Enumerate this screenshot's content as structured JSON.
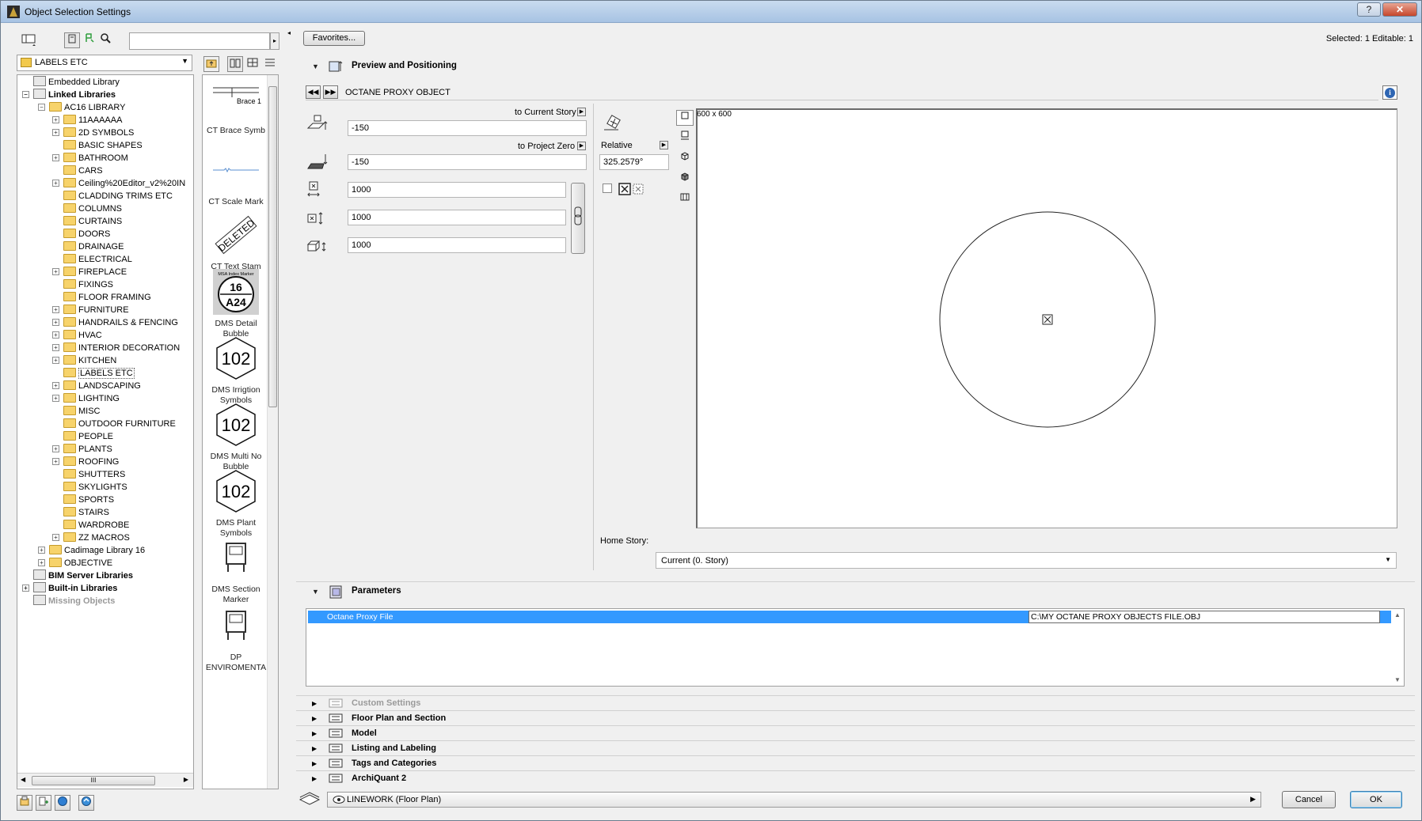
{
  "window": {
    "title": "Object Selection Settings",
    "help_label": "?",
    "close_label": "✕"
  },
  "library": {
    "current_folder": "LABELS ETC",
    "search_placeholder": "",
    "tree": [
      {
        "label": "Embedded Library",
        "level": 1,
        "icon": "library-icon",
        "expander": "",
        "style": "normal"
      },
      {
        "label": "Linked Libraries",
        "level": 1,
        "icon": "library-icon",
        "expander": "−",
        "style": "bold"
      },
      {
        "label": "AC16 LIBRARY",
        "level": 2,
        "icon": "folder-icon",
        "expander": "−",
        "style": "normal"
      },
      {
        "label": "11AAAAAA",
        "level": 3,
        "icon": "folder-icon",
        "expander": "+",
        "style": "normal"
      },
      {
        "label": "2D SYMBOLS",
        "level": 3,
        "icon": "folder-icon",
        "expander": "+",
        "style": "normal"
      },
      {
        "label": "BASIC SHAPES",
        "level": 3,
        "icon": "folder-icon",
        "expander": "",
        "style": "normal"
      },
      {
        "label": "BATHROOM",
        "level": 3,
        "icon": "folder-icon",
        "expander": "+",
        "style": "normal"
      },
      {
        "label": "CARS",
        "level": 3,
        "icon": "folder-icon",
        "expander": "",
        "style": "normal"
      },
      {
        "label": "Ceiling%20Editor_v2%20IN",
        "level": 3,
        "icon": "folder-icon",
        "expander": "+",
        "style": "normal"
      },
      {
        "label": "CLADDING TRIMS ETC",
        "level": 3,
        "icon": "folder-icon",
        "expander": "",
        "style": "normal"
      },
      {
        "label": "COLUMNS",
        "level": 3,
        "icon": "folder-icon",
        "expander": "",
        "style": "normal"
      },
      {
        "label": "CURTAINS",
        "level": 3,
        "icon": "folder-icon",
        "expander": "",
        "style": "normal"
      },
      {
        "label": "DOORS",
        "level": 3,
        "icon": "folder-icon",
        "expander": "",
        "style": "normal"
      },
      {
        "label": "DRAINAGE",
        "level": 3,
        "icon": "folder-icon",
        "expander": "",
        "style": "normal"
      },
      {
        "label": "ELECTRICAL",
        "level": 3,
        "icon": "folder-icon",
        "expander": "",
        "style": "normal"
      },
      {
        "label": "FIREPLACE",
        "level": 3,
        "icon": "folder-icon",
        "expander": "+",
        "style": "normal"
      },
      {
        "label": "FIXINGS",
        "level": 3,
        "icon": "folder-icon",
        "expander": "",
        "style": "normal"
      },
      {
        "label": "FLOOR FRAMING",
        "level": 3,
        "icon": "folder-icon",
        "expander": "",
        "style": "normal"
      },
      {
        "label": "FURNITURE",
        "level": 3,
        "icon": "folder-icon",
        "expander": "+",
        "style": "normal"
      },
      {
        "label": "HANDRAILS & FENCING",
        "level": 3,
        "icon": "folder-icon",
        "expander": "+",
        "style": "normal"
      },
      {
        "label": "HVAC",
        "level": 3,
        "icon": "folder-icon",
        "expander": "+",
        "style": "normal"
      },
      {
        "label": "INTERIOR DECORATION",
        "level": 3,
        "icon": "folder-icon",
        "expander": "+",
        "style": "normal"
      },
      {
        "label": "KITCHEN",
        "level": 3,
        "icon": "folder-icon",
        "expander": "+",
        "style": "normal"
      },
      {
        "label": "LABELS ETC",
        "level": 3,
        "icon": "folder-icon",
        "expander": "",
        "style": "selected"
      },
      {
        "label": "LANDSCAPING",
        "level": 3,
        "icon": "folder-icon",
        "expander": "+",
        "style": "normal"
      },
      {
        "label": "LIGHTING",
        "level": 3,
        "icon": "folder-icon",
        "expander": "+",
        "style": "normal"
      },
      {
        "label": "MISC",
        "level": 3,
        "icon": "folder-icon",
        "expander": "",
        "style": "normal"
      },
      {
        "label": "OUTDOOR FURNITURE",
        "level": 3,
        "icon": "folder-icon",
        "expander": "",
        "style": "normal"
      },
      {
        "label": "PEOPLE",
        "level": 3,
        "icon": "folder-icon",
        "expander": "",
        "style": "normal"
      },
      {
        "label": "PLANTS",
        "level": 3,
        "icon": "folder-icon",
        "expander": "+",
        "style": "normal"
      },
      {
        "label": "ROOFING",
        "level": 3,
        "icon": "folder-icon",
        "expander": "+",
        "style": "normal"
      },
      {
        "label": "SHUTTERS",
        "level": 3,
        "icon": "folder-icon",
        "expander": "",
        "style": "normal"
      },
      {
        "label": "SKYLIGHTS",
        "level": 3,
        "icon": "folder-icon",
        "expander": "",
        "style": "normal"
      },
      {
        "label": "SPORTS",
        "level": 3,
        "icon": "folder-icon",
        "expander": "",
        "style": "normal"
      },
      {
        "label": "STAIRS",
        "level": 3,
        "icon": "folder-icon",
        "expander": "",
        "style": "normal"
      },
      {
        "label": "WARDROBE",
        "level": 3,
        "icon": "folder-icon",
        "expander": "",
        "style": "normal"
      },
      {
        "label": "ZZ MACROS",
        "level": 3,
        "icon": "folder-icon",
        "expander": "+",
        "style": "normal"
      },
      {
        "label": "Cadimage Library 16",
        "level": 2,
        "icon": "folder-icon",
        "expander": "+",
        "style": "normal"
      },
      {
        "label": "OBJECTIVE",
        "level": 2,
        "icon": "folder-icon",
        "expander": "+",
        "style": "normal"
      },
      {
        "label": "BIM Server Libraries",
        "level": 1,
        "icon": "library-icon",
        "expander": "",
        "style": "bold"
      },
      {
        "label": "Built-in Libraries",
        "level": 1,
        "icon": "library-icon",
        "expander": "+",
        "style": "bold"
      },
      {
        "label": "Missing Objects",
        "level": 1,
        "icon": "library-icon",
        "expander": "",
        "style": "grey"
      }
    ],
    "scroll_grip": "III",
    "thumbnails": [
      {
        "label": "CT Brace Symb",
        "preview_text": "Brace 1",
        "kind": "brace"
      },
      {
        "label": "CT Scale Mark",
        "preview_text": "",
        "kind": "scale"
      },
      {
        "label": "CT Text Stam",
        "preview_text": "DELETED",
        "kind": "stamp"
      },
      {
        "label": "DMS Detail Bubble",
        "preview_text": "16",
        "preview_text2": "A24",
        "preview_top": "MSA Index Marker",
        "kind": "bubble"
      },
      {
        "label": "DMS Irrigtion Symbols",
        "preview_text": "102",
        "kind": "hex"
      },
      {
        "label": "DMS Multi No Bubble",
        "preview_text": "102",
        "kind": "hex"
      },
      {
        "label": "DMS Plant Symbols",
        "preview_text": "102",
        "kind": "hex"
      },
      {
        "label": "DMS Section Marker",
        "preview_text": "",
        "kind": "chair"
      },
      {
        "label": "DP ENVIROMENTA",
        "preview_text": "",
        "kind": "chair"
      }
    ]
  },
  "header": {
    "favorites_label": "Favorites...",
    "selection_info": "Selected: 1 Editable: 1"
  },
  "preview_section": {
    "title": "Preview and Positioning",
    "object_name": "OCTANE PROXY OBJECT",
    "to_current_story_label": "to Current Story",
    "to_current_story_value": "-150",
    "to_project_zero_label": "to Project Zero",
    "to_project_zero_value": "-150",
    "width_value": "1000",
    "depth_value": "1000",
    "height_value": "1000",
    "relative_label": "Relative",
    "angle_value": "325.2579°",
    "canvas_size_label": "600 x 600",
    "home_story_label": "Home Story:",
    "home_story_value": "Current (0. Story)"
  },
  "parameters_section": {
    "title": "Parameters",
    "rows": [
      {
        "name": "Octane Proxy File",
        "value": "C:\\MY OCTANE PROXY OBJECTS FILE.OBJ"
      }
    ]
  },
  "collapsed_sections": [
    {
      "title": "Custom Settings",
      "disabled": true
    },
    {
      "title": "Floor Plan and Section",
      "disabled": false
    },
    {
      "title": "Model",
      "disabled": false
    },
    {
      "title": "Listing and Labeling",
      "disabled": false
    },
    {
      "title": "Tags and Categories",
      "disabled": false
    },
    {
      "title": "ArchiQuant 2",
      "disabled": false
    }
  ],
  "footer": {
    "layer_value": "LINEWORK (Floor Plan)",
    "cancel_label": "Cancel",
    "ok_label": "OK"
  },
  "colors": {
    "selection_blue": "#3399ff",
    "title_bar": "#b6cfec",
    "info_blue": "#2f66b3"
  }
}
